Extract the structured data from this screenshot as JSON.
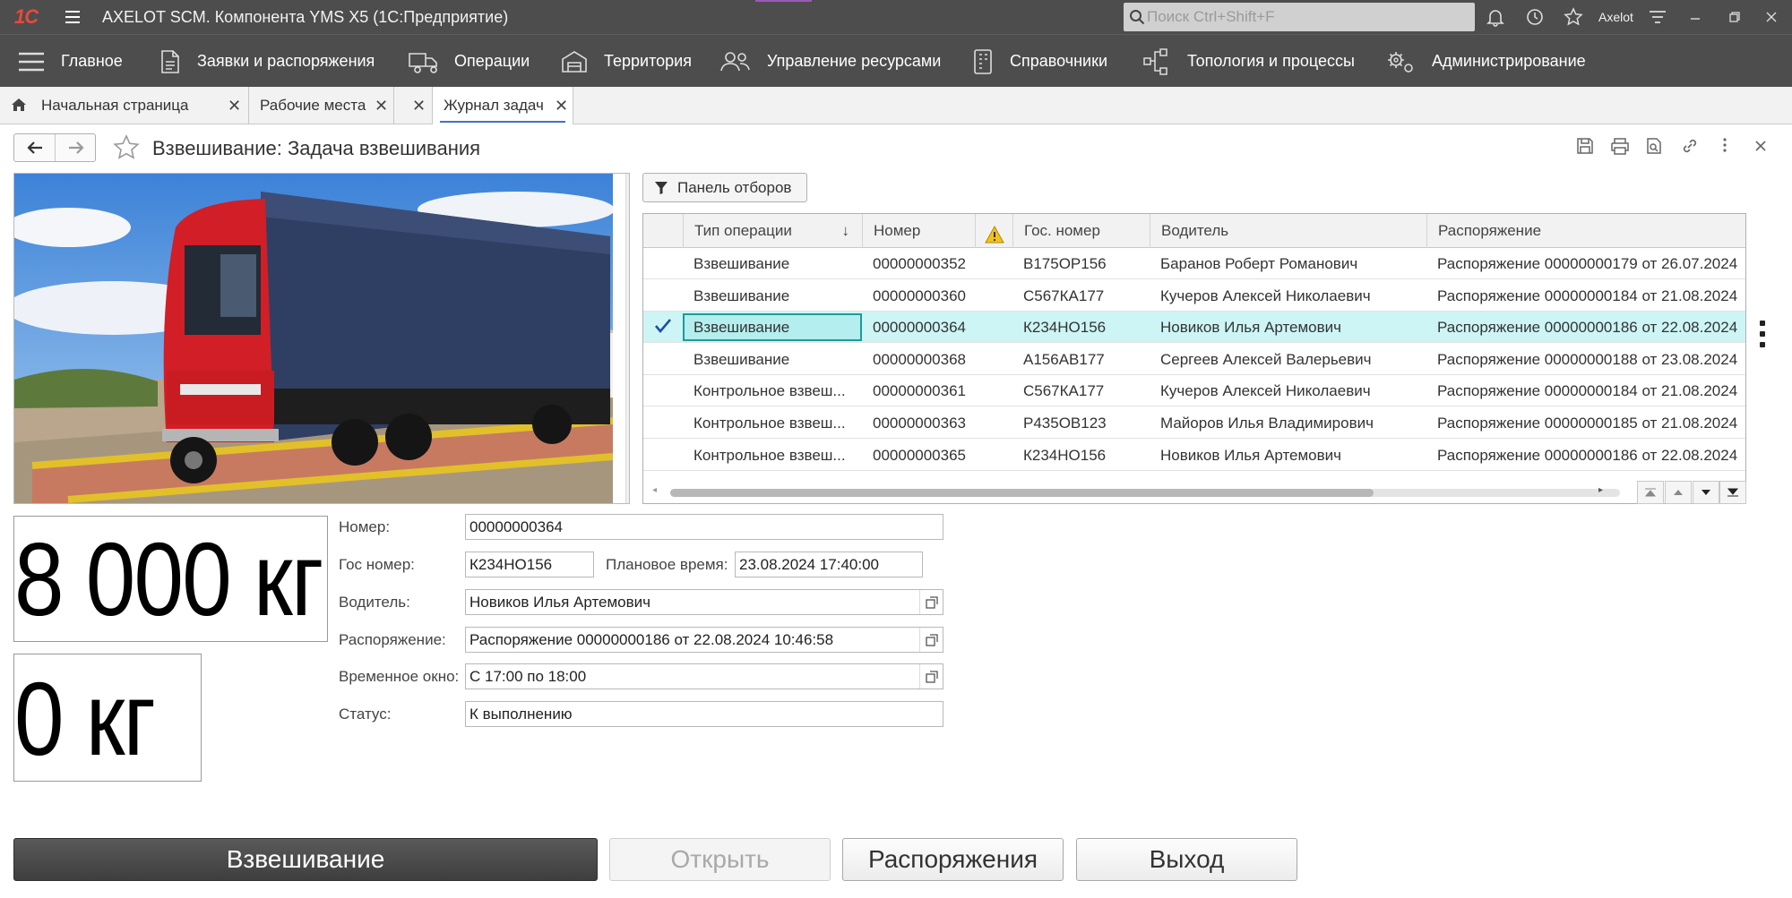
{
  "titlebar": {
    "logo": "1С",
    "app_title": "AXELOT SCM. Компонента YMS X5  (1С:Предприятие)",
    "search_placeholder": "Поиск Ctrl+Shift+F",
    "user": "Axelot"
  },
  "menu": [
    {
      "label": "Главное",
      "icon": "hamburger-icon"
    },
    {
      "label": "Заявки и распоряжения",
      "icon": "document-icon"
    },
    {
      "label": "Операции",
      "icon": "truck-icon"
    },
    {
      "label": "Территория",
      "icon": "warehouse-icon"
    },
    {
      "label": "Управление ресурсами",
      "icon": "people-icon"
    },
    {
      "label": "Справочники",
      "icon": "catalog-icon"
    },
    {
      "label": "Топология и процессы",
      "icon": "topology-icon"
    },
    {
      "label": "Администрирование",
      "icon": "gears-icon"
    }
  ],
  "tabs": [
    {
      "label": "Начальная страница"
    },
    {
      "label": "Рабочие места"
    },
    {
      "label": "Журнал задач"
    }
  ],
  "form": {
    "title": "Взвешивание: Задача взвешивания"
  },
  "filter_button": "Панель отборов",
  "grid": {
    "headers": [
      "Тип операции",
      "Номер",
      "Гос. номер",
      "Водитель",
      "Распоряжение"
    ],
    "rows": [
      {
        "type": "Взвешивание",
        "number": "00000000352",
        "plate": "В175ОР156",
        "driver": "Баранов Роберт Романович",
        "order": "Распоряжение 00000000179 от 26.07.2024"
      },
      {
        "type": "Взвешивание",
        "number": "00000000360",
        "plate": "С567КА177",
        "driver": "Кучеров Алексей Николаевич",
        "order": "Распоряжение 00000000184 от 21.08.2024"
      },
      {
        "type": "Взвешивание",
        "number": "00000000364",
        "plate": "К234НО156",
        "driver": "Новиков Илья Артемович",
        "order": "Распоряжение 00000000186 от 22.08.2024"
      },
      {
        "type": "Взвешивание",
        "number": "00000000368",
        "plate": " А156АВ177",
        "driver": "Сергеев Алексей Валерьевич",
        "order": "Распоряжение 00000000188 от 23.08.2024"
      },
      {
        "type": "Контрольное взвеш...",
        "number": "00000000361",
        "plate": "С567КА177",
        "driver": "Кучеров Алексей Николаевич",
        "order": "Распоряжение 00000000184 от 21.08.2024"
      },
      {
        "type": "Контрольное взвеш...",
        "number": "00000000363",
        "plate": "Р435ОВ123",
        "driver": "Майоров Илья Владимирович",
        "order": "Распоряжение 00000000185 от 21.08.2024"
      },
      {
        "type": "Контрольное взвеш...",
        "number": "00000000365",
        "plate": "К234НО156",
        "driver": "Новиков Илья Артемович",
        "order": "Распоряжение 00000000186 от 22.08.2024"
      }
    ],
    "selected_row": 2
  },
  "weights": {
    "gross": "8 000 кг",
    "tare": "0 кг"
  },
  "details": {
    "number_label": "Номер:",
    "number_value": "00000000364",
    "plate_label": "Гос номер:",
    "plate_value": "К234НО156",
    "plan_time_label": "Плановое время:",
    "plan_time_value": "23.08.2024 17:40:00",
    "driver_label": "Водитель:",
    "driver_value": "Новиков Илья Артемович",
    "order_label": "Распоряжение:",
    "order_value": "Распоряжение 00000000186 от 22.08.2024 10:46:58",
    "window_label": "Временное окно:",
    "window_value": "С 17:00 по 18:00",
    "status_label": "Статус:",
    "status_value": "К выполнению"
  },
  "buttons": {
    "weigh": "Взвешивание",
    "open": "Открыть",
    "orders": "Распоряжения",
    "exit": "Выход"
  },
  "colors": {
    "chrome": "#4d4d4d",
    "selected_row": "#cdf5f5",
    "selected_cell_border": "#1e9a9a",
    "logo": "#e8493c",
    "active_tab_underline": "#3b73c4"
  }
}
